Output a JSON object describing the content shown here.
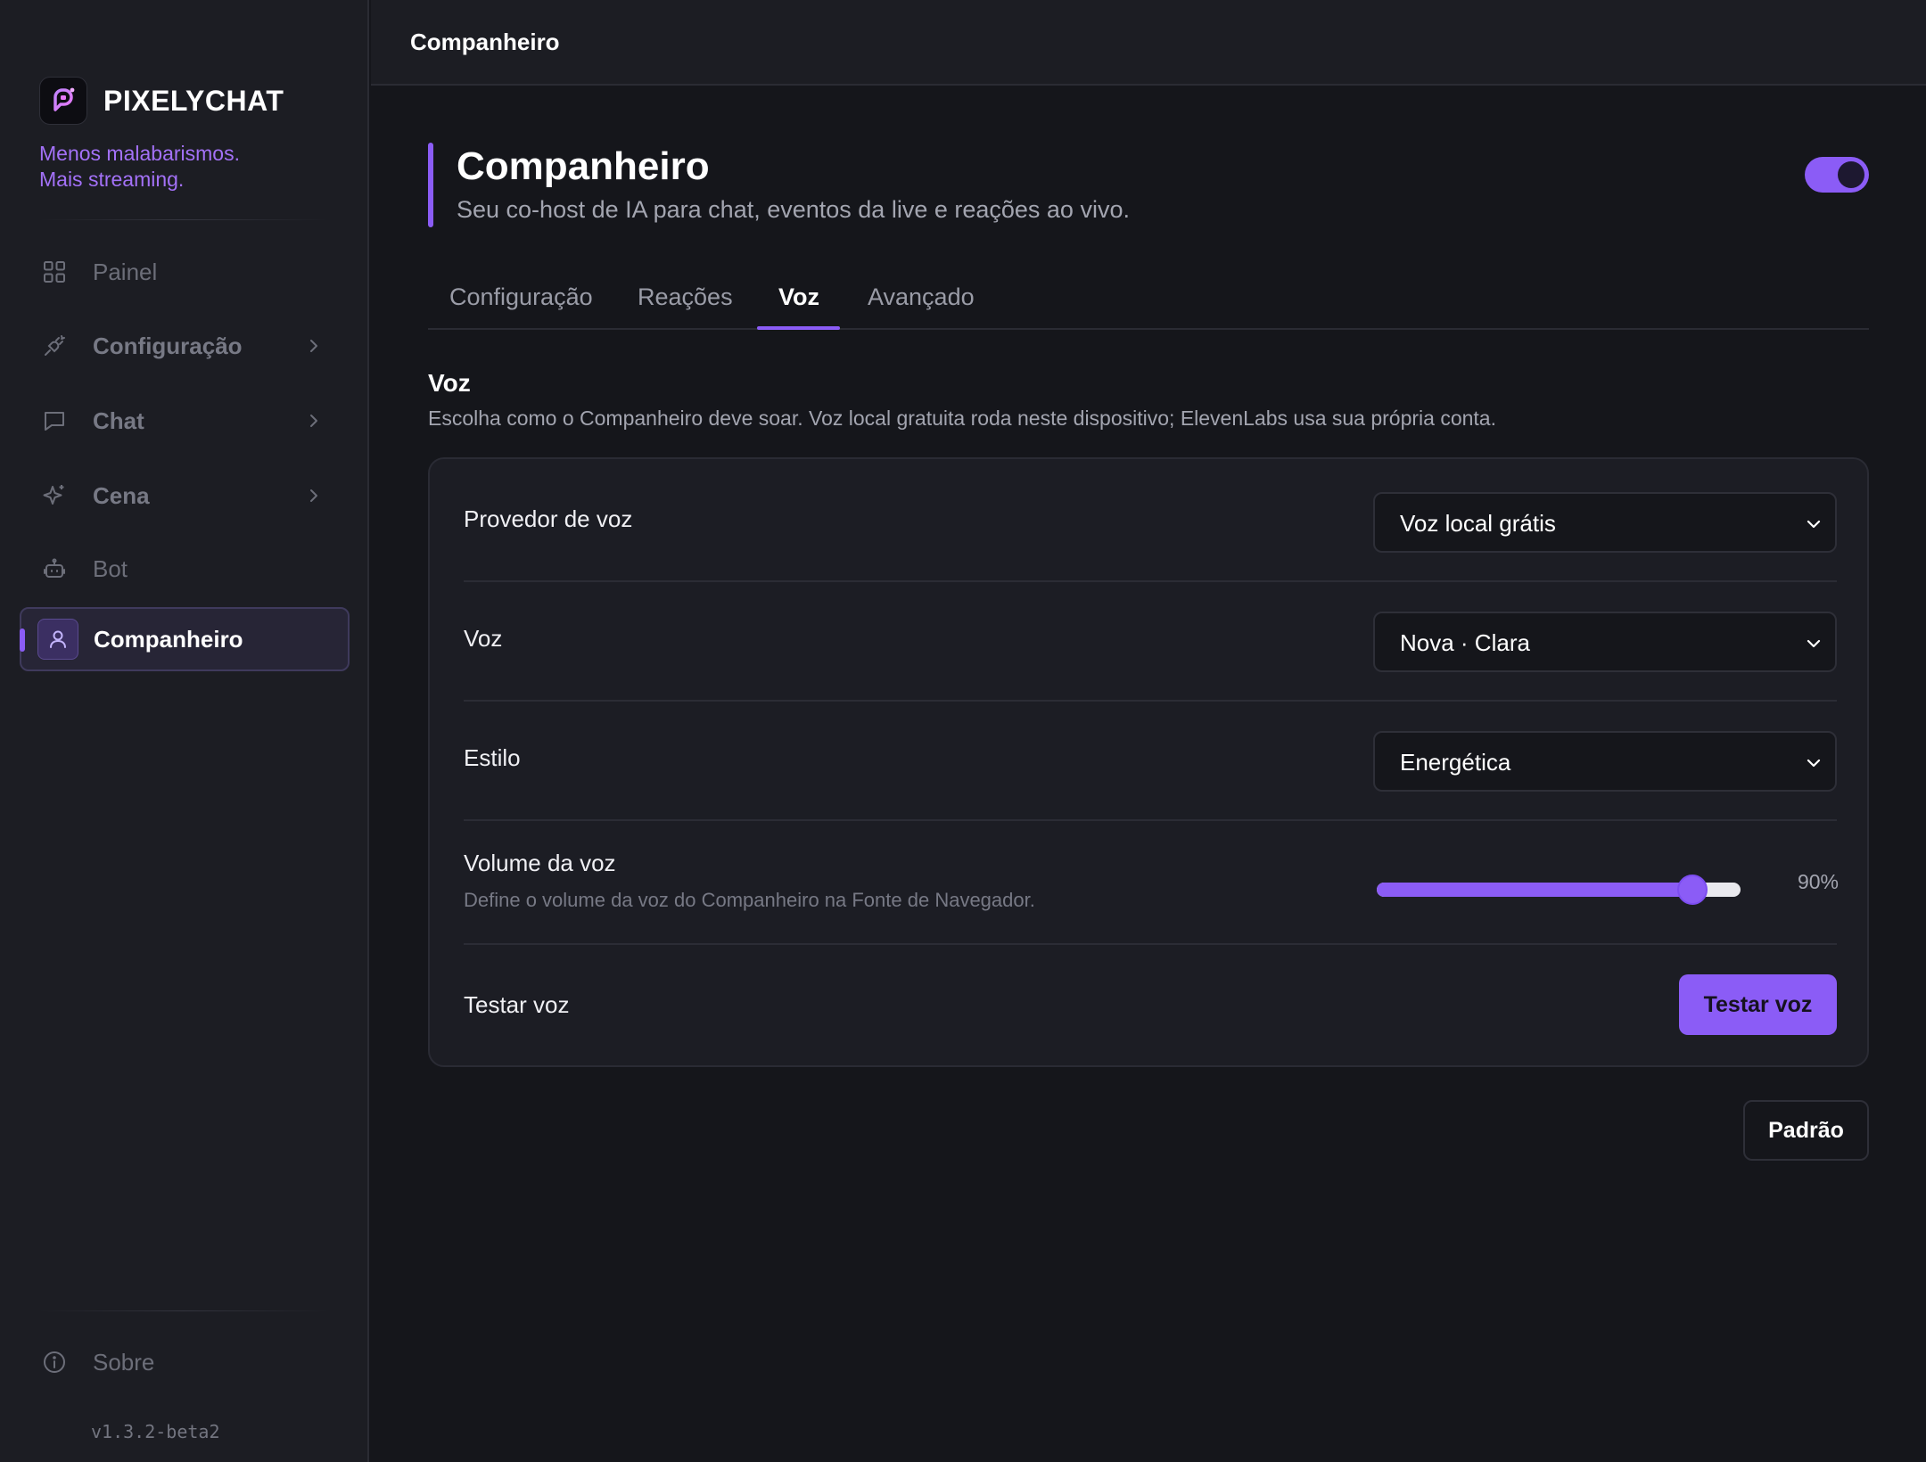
{
  "sidebar": {
    "brand_name": "PIXELYCHAT",
    "tagline_line1": "Menos malabarismos.",
    "tagline_line2": "Mais streaming.",
    "items": [
      {
        "label": "Painel",
        "icon": "grid-icon"
      },
      {
        "label": "Configuração",
        "icon": "plug-icon"
      },
      {
        "label": "Chat",
        "icon": "message-icon"
      },
      {
        "label": "Cena",
        "icon": "sparkles-icon"
      },
      {
        "label": "Bot",
        "icon": "robot-icon"
      },
      {
        "label": "Companheiro",
        "icon": "user-icon"
      }
    ],
    "footer": {
      "label": "Sobre",
      "icon": "info-icon"
    },
    "version": "v1.3.2-beta2"
  },
  "topbar": {
    "title": "Companheiro"
  },
  "header": {
    "title": "Companheiro",
    "subtitle": "Seu co-host de IA para chat, eventos da live e reações ao vivo.",
    "enabled": true
  },
  "tabs": [
    {
      "label": "Configuração"
    },
    {
      "label": "Reações"
    },
    {
      "label": "Voz"
    },
    {
      "label": "Avançado"
    }
  ],
  "active_tab": "Voz",
  "section": {
    "title": "Voz",
    "description": "Escolha como o Companheiro deve soar. Voz local gratuita roda neste dispositivo; ElevenLabs usa sua própria conta."
  },
  "settings": {
    "provider": {
      "label": "Provedor de voz",
      "value": "Voz local grátis"
    },
    "voice": {
      "label": "Voz",
      "value": "Nova · Clara"
    },
    "style": {
      "label": "Estilo",
      "value": "Energética"
    },
    "volume": {
      "label": "Volume da voz",
      "hint": "Define o volume da voz do Companheiro na Fonte de Navegador.",
      "value": 0.9,
      "display": "90%"
    },
    "test": {
      "label": "Testar voz",
      "button_label": "Testar voz"
    }
  },
  "footer_actions": {
    "reset_label": "Padrão"
  },
  "colors": {
    "accent": "#8b5cf6",
    "background": "#15161b",
    "sidebar": "#1c1d23"
  }
}
